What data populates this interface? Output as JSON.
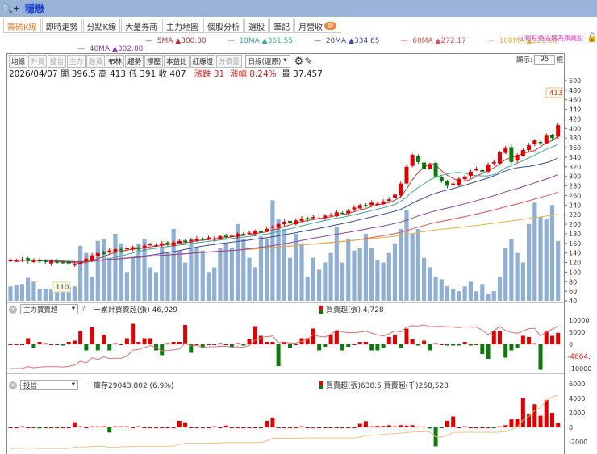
{
  "title": {
    "zoom_icon": "zoom-in-icon",
    "label": "+",
    "stock": "穩懋"
  },
  "tabs": [
    {
      "label": "籌碼K線",
      "active": true
    },
    {
      "label": "即時走勢"
    },
    {
      "label": "分點K線"
    },
    {
      "label": "大量券商"
    },
    {
      "label": "主力地圖"
    },
    {
      "label": "個股分析"
    },
    {
      "label": "選股"
    },
    {
      "label": "筆記"
    },
    {
      "label": "月營收",
      "badge": "新"
    }
  ],
  "ma_legend": [
    {
      "name": "5MA",
      "value": "▲380.30",
      "color": "#b03a3a"
    },
    {
      "name": "10MA",
      "value": "▲361.55",
      "color": "#3aa89a"
    },
    {
      "name": "20MA",
      "value": "▲334.65",
      "color": "#3a4a9a"
    },
    {
      "name": "60MA",
      "value": "▲272.17",
      "color": "#e05050"
    },
    {
      "name": "100MA",
      "value": "▲221.90",
      "color": "#e8b040"
    },
    {
      "name": "40MA",
      "value": "▲302.88",
      "color": "#9040a0"
    }
  ],
  "note": "ⓘ粉紅色區塊為庫藏股",
  "toolbar": {
    "buttons": [
      {
        "label": "均線"
      },
      {
        "label": "外資",
        "disabled": true
      },
      {
        "label": "投信",
        "disabled": true
      },
      {
        "label": "主力",
        "disabled": true
      },
      {
        "label": "融資",
        "disabled": true
      },
      {
        "label": "布林"
      },
      {
        "label": "趨勢"
      },
      {
        "label": "撐壓"
      },
      {
        "label": "本益比"
      },
      {
        "label": "紅綠燈"
      },
      {
        "label": "分價量",
        "disabled": true
      }
    ],
    "period": "日線(還原)",
    "show_label": "顯示:",
    "show_count": "95",
    "show_unit": "根"
  },
  "info": {
    "date": "2026/04/07",
    "open_label": "開",
    "open": "396.5",
    "high_label": "高",
    "high": "413",
    "low_label": "低",
    "low": "391",
    "close_label": "收",
    "close": "407",
    "change_label": "漲跌",
    "change": "31",
    "pct_label": "漲幅",
    "pct": "8.24%",
    "vol_label": "量",
    "vol": "37,457"
  },
  "high_marker": "413",
  "low_marker": "110",
  "panel2": {
    "indicator": "主力買賣超",
    "help": "?",
    "cum_label": "一累計買賣超(張) 46,029",
    "bar_label": "買賣超(張) 4,728",
    "last_cum": "-4664."
  },
  "panel3": {
    "indicator": "投信",
    "inv_label": "一庫存29043.802 (6.9%)",
    "bar_label": "買賣超(張)638.5 買賣超(千)258,528"
  },
  "colors": {
    "up": "#e00000",
    "down": "#0a7a0a",
    "volume": "#8fb0d4"
  },
  "chart_data": [
    {
      "type": "candlestick",
      "title": "price",
      "yticks": [
        40,
        60,
        80,
        100,
        120,
        140,
        160,
        180,
        200,
        220,
        240,
        260,
        280,
        300,
        320,
        340,
        360,
        380,
        400,
        420,
        440,
        460,
        480,
        500
      ],
      "ylim": [
        40,
        500
      ],
      "close": [
        125,
        124,
        126,
        123,
        125,
        122,
        121,
        123,
        120,
        119,
        118,
        117,
        120,
        128,
        135,
        140,
        138,
        145,
        148,
        146,
        150,
        152,
        149,
        155,
        158,
        156,
        160,
        158,
        162,
        165,
        163,
        167,
        170,
        168,
        172,
        170,
        175,
        173,
        176,
        180,
        178,
        182,
        186,
        184,
        190,
        195,
        200,
        205,
        203,
        208,
        212,
        210,
        215,
        213,
        218,
        220,
        225,
        222,
        228,
        235,
        240,
        238,
        245,
        243,
        248,
        252,
        262,
        285,
        320,
        345,
        330,
        315,
        325,
        300,
        290,
        280,
        285,
        295,
        300,
        310,
        315,
        310,
        325,
        330,
        350,
        360,
        330,
        345,
        355,
        365,
        375,
        370,
        385,
        380,
        407
      ],
      "volume": [
        70,
        72,
        75,
        88,
        80,
        65,
        65,
        65,
        68,
        70,
        68,
        70,
        155,
        140,
        90,
        165,
        170,
        130,
        180,
        160,
        100,
        130,
        160,
        170,
        110,
        100,
        150,
        140,
        190,
        145,
        120,
        170,
        150,
        145,
        100,
        110,
        150,
        160,
        150,
        200,
        170,
        130,
        110,
        175,
        170,
        250,
        210,
        190,
        130,
        180,
        160,
        90,
        130,
        105,
        120,
        140,
        195,
        120,
        170,
        145,
        150,
        180,
        150,
        125,
        120,
        140,
        160,
        190,
        230,
        180,
        190,
        130,
        110,
        90,
        85,
        70,
        65,
        60,
        70,
        80,
        60,
        75,
        55,
        60,
        90,
        150,
        170,
        140,
        120,
        200,
        245,
        215,
        210,
        240,
        165
      ],
      "ma_periods": [
        5,
        10,
        20,
        40,
        60,
        100
      ]
    },
    {
      "type": "bar",
      "title": "主力買賣超",
      "yticks": [
        10000,
        5000,
        0,
        -10000
      ],
      "ylim": [
        -11000,
        11000
      ],
      "values": [
        0,
        0,
        0,
        2500,
        -1500,
        1000,
        500,
        0,
        0,
        -500,
        1000,
        1500,
        5500,
        -2500,
        7000,
        -2500,
        4000,
        -2500,
        500,
        0,
        2500,
        8500,
        1000,
        2500,
        2500,
        -2500,
        -4500,
        500,
        1000,
        1000,
        8000,
        -3500,
        0,
        -1500,
        0,
        0,
        500,
        0,
        -1000,
        500,
        -500,
        2000,
        7500,
        3500,
        1000,
        1000,
        -9000,
        1000,
        -1500,
        0,
        2500,
        2500,
        6500,
        -2500,
        -1000,
        4000,
        5500,
        -2500,
        -1000,
        0,
        1000,
        1000,
        -2500,
        -2500,
        -1500,
        3000,
        4000,
        -1500,
        6500,
        2000,
        -500,
        1500,
        -2500,
        500,
        0,
        -500,
        -500,
        -500,
        1000,
        -500,
        0,
        -4000,
        -6000,
        5500,
        5500,
        -5500,
        -2500,
        -1500,
        3500,
        3000,
        500,
        -10500,
        5500,
        3500,
        4728
      ]
    },
    {
      "type": "bar",
      "title": "投信",
      "yticks": [
        6000,
        4000,
        2000,
        0,
        -2000
      ],
      "ylim": [
        -3500,
        6500
      ],
      "values": [
        0,
        0,
        150,
        0,
        0,
        -150,
        0,
        0,
        0,
        0,
        0,
        700,
        150,
        0,
        150,
        150,
        150,
        -700,
        150,
        150,
        150,
        0,
        150,
        0,
        0,
        0,
        0,
        0,
        0,
        900,
        700,
        0,
        0,
        0,
        0,
        150,
        0,
        250,
        0,
        0,
        0,
        0,
        0,
        0,
        900,
        1350,
        0,
        0,
        0,
        0,
        150,
        0,
        0,
        0,
        0,
        0,
        0,
        0,
        0,
        0,
        500,
        850,
        150,
        200,
        200,
        300,
        150,
        300,
        250,
        300,
        100,
        100,
        -150,
        -2600,
        -100,
        900,
        1500,
        0,
        150,
        0,
        0,
        0,
        0,
        -100,
        150,
        300,
        1100,
        1150,
        4000,
        1850,
        3200,
        1600,
        3800,
        2000,
        638.5
      ]
    }
  ]
}
